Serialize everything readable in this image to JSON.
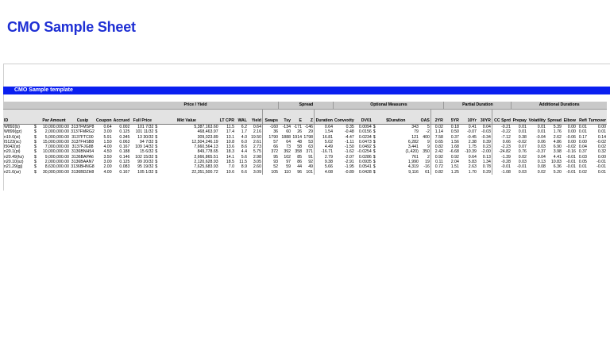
{
  "page": {
    "title": "CMO Sample Sheet"
  },
  "template_title": "CMO Sample template",
  "groups": [
    {
      "label": "",
      "span": 5
    },
    {
      "label": "Price / Yield",
      "span": 7
    },
    {
      "label": "Spread",
      "span": 4
    },
    {
      "label": "Optional Measures",
      "span": 6
    },
    {
      "label": "Partial Duration",
      "span": 4
    },
    {
      "label": "Additional Durations",
      "span": 7
    }
  ],
  "columns": [
    "ID",
    "",
    "Par Amount",
    "Cusip",
    "Coupon",
    "Accrued",
    "Full Price",
    "Mkt Value",
    "LT CPR",
    "WAL",
    "Yield",
    "Swaps",
    "Tsy",
    "E",
    "Z",
    "Duration",
    "Convexity",
    "DV01",
    "$Duration",
    "OAS",
    "2YR",
    "5YR",
    "10Yr",
    "30YR",
    "CC Sprd",
    "Prepay",
    "Volatility",
    "Spread",
    "Elbow",
    "Refi",
    "Turnover"
  ],
  "rows": [
    [
      "W892(b)",
      "$",
      "10,000,000.00",
      "3137FMSP8",
      "0.64",
      "0.002",
      "101 7/32",
      "$",
      "5,387,163.60",
      "11.5",
      "6.2",
      "0.64",
      "-160",
      "-134",
      "-171",
      "-146",
      "0.64",
      "0.35",
      "0.0094",
      "$",
      "343",
      "5",
      "0.02",
      "0.18",
      "0.41",
      "0.04",
      "-0.21",
      "0.01",
      "0.01",
      "5.39",
      "0.00",
      "0.01",
      "0.00"
    ],
    [
      "W899(gz)",
      "$",
      "2,000,000.00",
      "3137FMRG2",
      "3.00",
      "0.125",
      "101 11/32",
      "$",
      "468,463.97",
      "17.4",
      "1.7",
      "2.16",
      "36",
      "60",
      "26",
      "29",
      "1.54",
      "-0.48",
      "0.0156",
      "$",
      "79",
      "-2",
      "1.14",
      "0.50",
      "-0.07",
      "-0.03",
      "-0.22",
      "0.01",
      "0.01",
      "1.76",
      "0.00",
      "0.01",
      "0.01"
    ],
    [
      "n19.6(st)",
      "$",
      "5,000,000.00",
      "3137FTC00",
      "5.91",
      "0.345",
      "13 30/32",
      "$",
      "309,023.89",
      "13.1",
      "4.0",
      "19.50",
      "1790",
      "1888",
      "1914",
      "1798",
      "16.81",
      "-4.47",
      "0.0234",
      "$",
      "121",
      "400",
      "7.58",
      "0.37",
      "-0.45",
      "-0.34",
      "-7.12",
      "0.38",
      "-0.04",
      "2.62",
      "-0.06",
      "0.17",
      "0.14"
    ],
    [
      "I5123(sc)",
      "$",
      "15,000,000.00",
      "3137FHSB8",
      "1.50",
      "0.063",
      "94 7/32",
      "$",
      "12,504,246.19",
      "10.8",
      "6.0",
      "2.61",
      "57",
      "64",
      "48",
      "53",
      "5.02",
      "-1.11",
      "0.0473",
      "$",
      "6,282",
      "9",
      "0.65",
      "1.56",
      "2.38",
      "0.39",
      "0.66",
      "-0.02",
      "0.06",
      "4.86",
      "0.00",
      "0.00",
      "-0.02"
    ],
    [
      "I5042(st)",
      "$",
      "7,000,000.00",
      "3137FJG88",
      "4.00",
      "0.167",
      "109 14/32",
      "$",
      "7,660,564.13",
      "13.6",
      "8.6",
      "2.73",
      "66",
      "73",
      "58",
      "63",
      "4.49",
      "-1.50",
      "0.0492",
      "$",
      "3,441",
      "9",
      "0.82",
      "1.68",
      "1.75",
      "0.23",
      "-2.23",
      "0.07",
      "0.03",
      "6.90",
      "-0.02",
      "0.04",
      "0.02"
    ],
    [
      "n20.1(pi)",
      "$",
      "10,000,000.00",
      "3136BNH54",
      "4.50",
      "0.188",
      "15 6/32",
      "$",
      "849,778.65",
      "18.3",
      "4.4",
      "5.75",
      "372",
      "392",
      "358",
      "371",
      "-16.71",
      "-1.62",
      "-0.0254",
      "$",
      "(1,420)",
      "350",
      "2.42",
      "-6.68",
      "-10.39",
      "-2.00",
      "-24.82",
      "0.76",
      "-0.37",
      "3.98",
      "-0.16",
      "0.37",
      "0.32"
    ],
    [
      "n20.49(hz)",
      "$",
      "9,000,000.00",
      "3136BAPA6",
      "3.50",
      "0.146",
      "102 15/32",
      "$",
      "2,666,865.51",
      "14.1",
      "5.6",
      "2.98",
      "95",
      "102",
      "85",
      "91",
      "2.79",
      "-2.07",
      "0.0286",
      "$",
      "761",
      "2",
      "0.92",
      "0.92",
      "0.64",
      "0.13",
      "-1.39",
      "0.02",
      "0.04",
      "4.41",
      "-0.01",
      "0.03",
      "0.00"
    ],
    [
      "n20.10(sz)",
      "$",
      "2,000,000.00",
      "3136BAAN7",
      "3.00",
      "0.125",
      "99 20/32",
      "$",
      "2,120,628.93",
      "18.5",
      "11.5",
      "3.05",
      "93",
      "97",
      "86",
      "92",
      "9.38",
      "-2.91",
      "0.0935",
      "$",
      "1,990",
      "19",
      "0.11",
      "2.04",
      "5.83",
      "1.34",
      "-0.28",
      "0.03",
      "0.13",
      "10.83",
      "-0.01",
      "0.05",
      "-0.01"
    ],
    [
      "n21.29(gj)",
      "$",
      "8,630,000.00",
      "3136BHNG8",
      "2.00",
      "0.083",
      "95 19/32",
      "$",
      "7,625,683.93",
      "7.0",
      "8.9",
      "2.60",
      "52",
      "59",
      "44",
      "49",
      "5.66",
      "-1.95",
      "0.0541",
      "$",
      "4,319",
      "-16",
      "0.72",
      "1.51",
      "2.63",
      "0.78",
      "-0.01",
      "-0.01",
      "0.08",
      "6.36",
      "-0.01",
      "0.01",
      "-0.01"
    ],
    [
      "n21.6(ar)",
      "$",
      "30,000,000.00",
      "3136BDZH8",
      "4.00",
      "0.167",
      "105 1/32",
      "$",
      "22,351,500.72",
      "10.6",
      "6.6",
      "3.09",
      "105",
      "110",
      "96",
      "101",
      "4.08",
      "-0.89",
      "0.0428",
      "$",
      "9,116",
      "61",
      "0.82",
      "1.25",
      "1.70",
      "0.29",
      "-1.08",
      "0.03",
      "0.02",
      "5.20",
      "-0.01",
      "0.02",
      "0.01"
    ]
  ]
}
